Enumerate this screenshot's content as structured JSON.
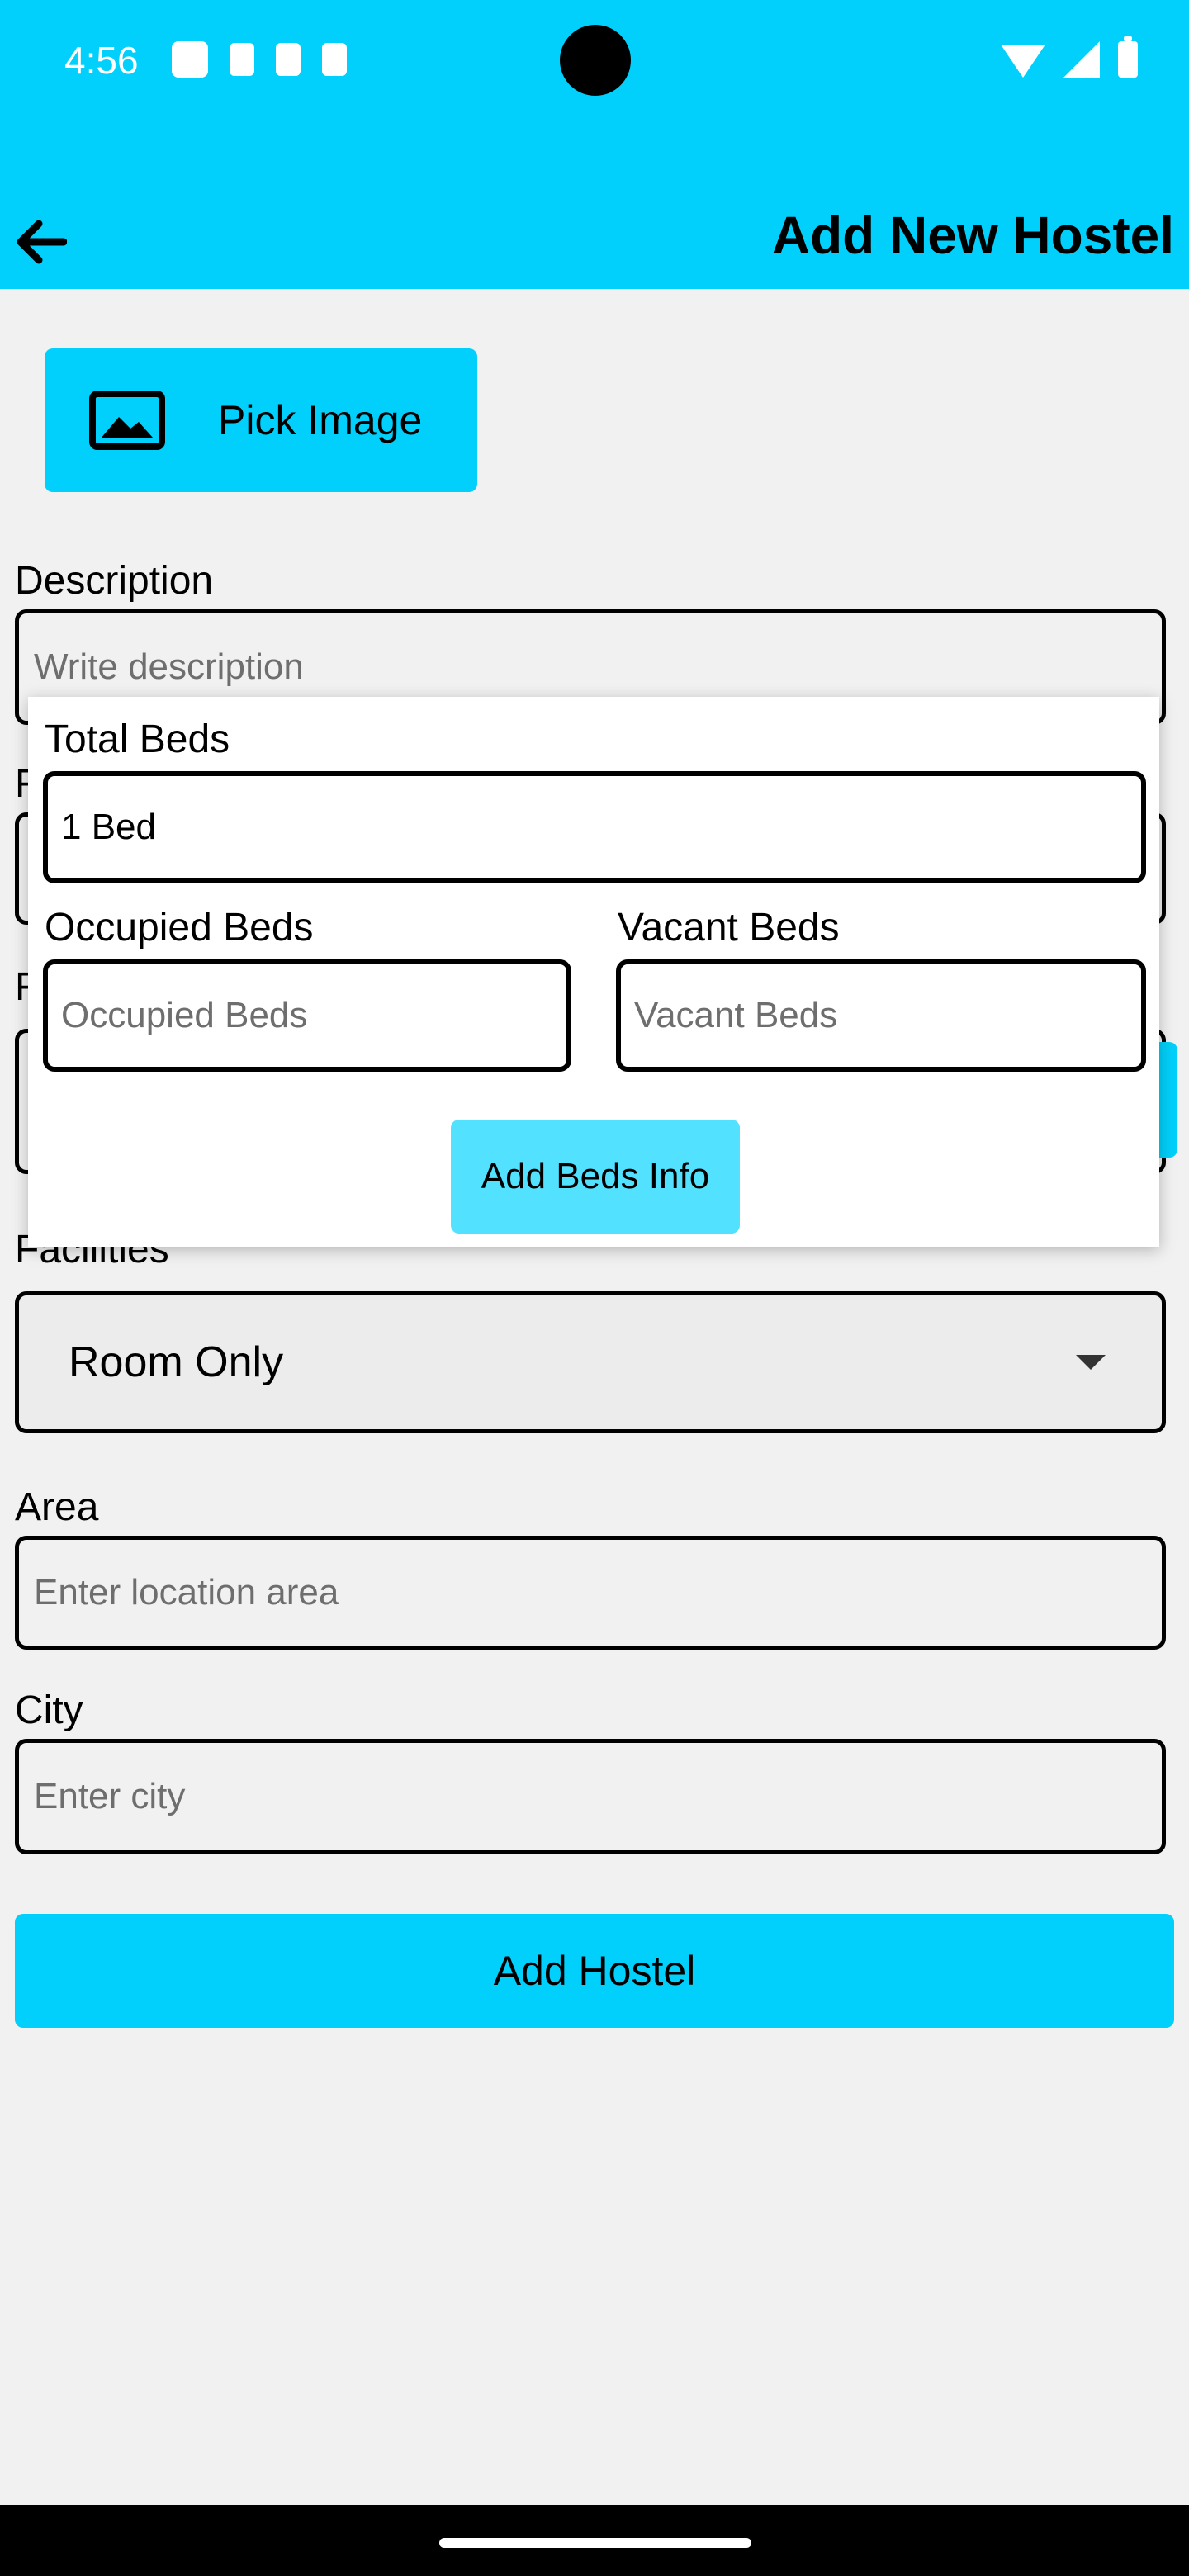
{
  "status_bar": {
    "time": "4:56"
  },
  "app_bar": {
    "title": "Add New Hostel"
  },
  "pick_image": {
    "label": "Pick Image"
  },
  "description": {
    "label": "Description",
    "placeholder": "Write description"
  },
  "peek": {
    "p1": "F",
    "p2": "F",
    "p3": "Facilities"
  },
  "beds_dialog": {
    "total_label": "Total Beds",
    "total_value": "1 Bed",
    "occupied_label": "Occupied Beds",
    "occupied_placeholder": "Occupied Beds",
    "vacant_label": "Vacant Beds",
    "vacant_placeholder": "Vacant Beds",
    "button_label": "Add Beds Info"
  },
  "facilities": {
    "selected": "Room Only"
  },
  "area": {
    "label": "Area",
    "placeholder": "Enter location area"
  },
  "city": {
    "label": "City",
    "placeholder": "Enter city"
  },
  "submit": {
    "label": "Add Hostel"
  },
  "colors": {
    "accent": "#00d0fb",
    "dialog_button": "#52e2ff",
    "background": "#f1f1f1"
  }
}
